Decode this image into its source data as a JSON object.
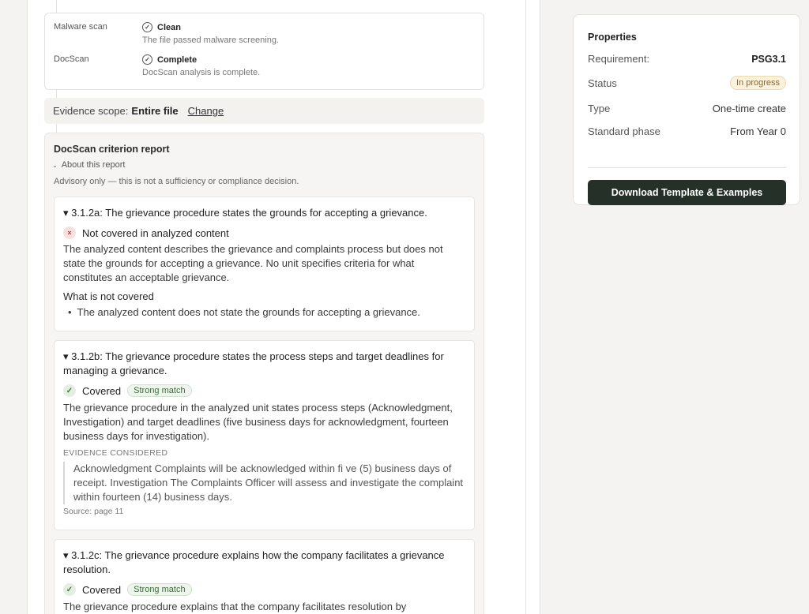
{
  "scans": [
    {
      "label": "Malware scan",
      "status": "Clean",
      "description": "The file passed malware screening."
    },
    {
      "label": "DocScan",
      "status": "Complete",
      "description": "DocScan analysis is complete."
    }
  ],
  "scope": {
    "label": "Evidence scope:",
    "value": "Entire file",
    "change": "Change"
  },
  "report": {
    "title": "DocScan criterion report",
    "about": "About this report",
    "advisory": "Advisory only — this is not a sufficiency or compliance decision.",
    "criteria": [
      {
        "title": "▾ 3.1.2a: The grievance procedure states the grounds for accepting a grievance.",
        "status": "Not covered in analyzed content",
        "body": "The analyzed content describes the grievance and complaints process but does not state the grounds for accepting a grievance. No unit specifies criteria for what constitutes an acceptable grievance.",
        "not_covered_head": "What is not covered",
        "not_covered_item": "The analyzed content does not state the grounds for accepting a grievance."
      },
      {
        "title": "▾ 3.1.2b: The grievance procedure states the process steps and target deadlines for managing a grievance.",
        "status": "Covered",
        "match": "Strong match",
        "body": "The grievance procedure in the analyzed unit states process steps (Acknowledgment, Investigation) and target deadlines (five business days for acknowledgment, fourteen business days for investigation).",
        "evidence_label": "EVIDENCE CONSIDERED",
        "evidence": "Acknowledgment Complaints will be acknowledged within fi ve (5) business days of receipt. Investigation The Complaints Officer will assess and investigate the complaint within fourteen (14) business days.",
        "source": "Source: page 11"
      },
      {
        "title": "▾ 3.1.2c: The grievance procedure explains how the company facilitates a grievance resolution.",
        "status": "Covered",
        "match": "Strong match",
        "body": "The grievance procedure explains that the company facilitates resolution by"
      }
    ]
  },
  "properties": {
    "title": "Properties",
    "requirement_label": "Requirement:",
    "requirement_value": "PSG3.1",
    "status_label": "Status",
    "status_value": "In progress",
    "type_label": "Type",
    "type_value": "One-time create",
    "phase_label": "Standard phase",
    "phase_value": "From Year 0",
    "download": "Download Template & Examples"
  }
}
